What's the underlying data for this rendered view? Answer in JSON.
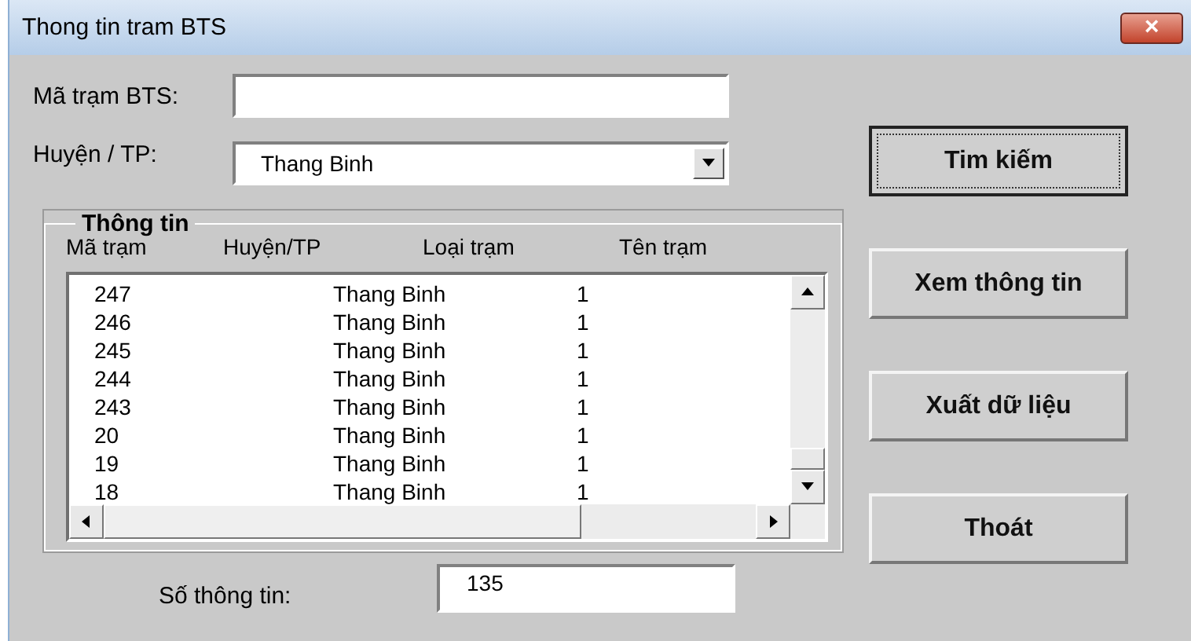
{
  "window": {
    "title": "Thong tin tram BTS",
    "close": "×"
  },
  "fields": [
    {
      "label": "Mã trạm BTS:"
    },
    {
      "label": "Huyện / TP:",
      "value": "Thang Binh",
      "kind": "dropdown"
    }
  ],
  "group": {
    "title": "Thông tin",
    "columns": [
      "Mã trạm",
      "Huyện/TP",
      "Loại trạm",
      "Tên trạm"
    ],
    "rows": [
      [
        "247",
        "Thang Binh",
        "1"
      ],
      [
        "246",
        "Thang Binh",
        "1"
      ],
      [
        "245",
        "Thang Binh",
        "1"
      ],
      [
        "244",
        "Thang Binh",
        "1"
      ],
      [
        "243",
        "Thang Binh",
        "1"
      ],
      [
        "20",
        "Thang Binh",
        "1"
      ],
      [
        "19",
        "Thang Binh",
        "1"
      ],
      [
        "18",
        "Thang Binh",
        "1"
      ]
    ]
  },
  "count": {
    "label": "Số thông tin:",
    "value": "135"
  },
  "buttons": [
    {
      "label": "Tim kiếm",
      "focused": true
    },
    {
      "label": "Xem thông tin",
      "focused": false
    },
    {
      "label": "Xuất dữ liệu",
      "focused": false
    },
    {
      "label": "Thoát",
      "focused": false
    }
  ]
}
